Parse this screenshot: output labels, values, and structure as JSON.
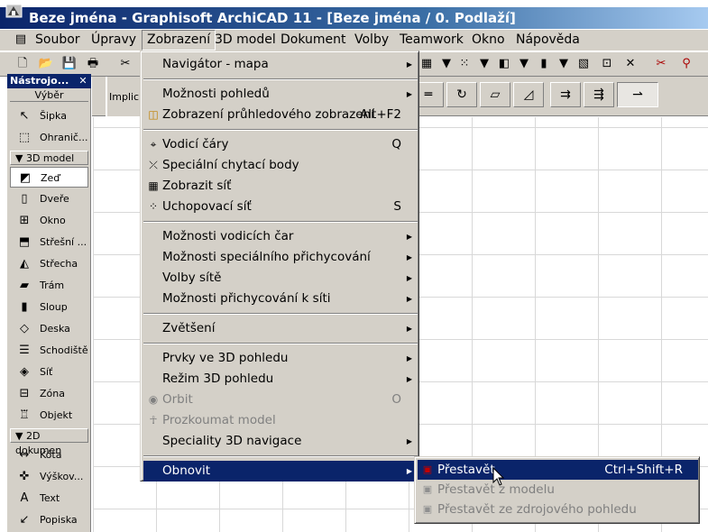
{
  "window": {
    "title": "Beze jména - Graphisoft ArchiCAD 11 - [Beze jména / 0. Podlaží]"
  },
  "menubar": [
    {
      "label": "Soubor",
      "active": false
    },
    {
      "label": "Úpravy",
      "active": false
    },
    {
      "label": "Zobrazení",
      "active": true
    },
    {
      "label": "3D model",
      "active": false
    },
    {
      "label": "Dokument",
      "active": false
    },
    {
      "label": "Volby",
      "active": false
    },
    {
      "label": "Teamwork",
      "active": false
    },
    {
      "label": "Okno",
      "active": false
    },
    {
      "label": "Nápověda",
      "active": false
    }
  ],
  "toolbox": {
    "title": "Nástrojo...",
    "select_label": "Výběr",
    "info_label": "Implicit",
    "groups": [
      {
        "header": null,
        "tools": [
          {
            "label": "Šipka",
            "icon": "arrow-icon"
          },
          {
            "label": "Ohranič...",
            "icon": "marquee-icon"
          }
        ]
      },
      {
        "header": "3D model",
        "tools": [
          {
            "label": "Zeď",
            "icon": "wall-icon",
            "selected": true
          },
          {
            "label": "Dveře",
            "icon": "door-icon"
          },
          {
            "label": "Okno",
            "icon": "window-icon"
          },
          {
            "label": "Střešní ...",
            "icon": "skylight-icon"
          },
          {
            "label": "Střecha",
            "icon": "roof-icon"
          },
          {
            "label": "Trám",
            "icon": "beam-icon"
          },
          {
            "label": "Sloup",
            "icon": "column-icon"
          },
          {
            "label": "Deska",
            "icon": "slab-icon"
          },
          {
            "label": "Schodiště",
            "icon": "stair-icon"
          },
          {
            "label": "Síť",
            "icon": "mesh-icon"
          },
          {
            "label": "Zóna",
            "icon": "zone-icon"
          },
          {
            "label": "Objekt",
            "icon": "object-icon"
          }
        ]
      },
      {
        "header": "2D dokumen",
        "tools": [
          {
            "label": "Kóta",
            "icon": "dimension-icon"
          },
          {
            "label": "Výškov...",
            "icon": "level-dimension-icon"
          },
          {
            "label": "Text",
            "icon": "text-icon"
          },
          {
            "label": "Popiska",
            "icon": "label-icon"
          }
        ]
      }
    ]
  },
  "view_menu": {
    "items": [
      {
        "label": "Navigátor - mapa",
        "submenu": true
      },
      {
        "sep": true
      },
      {
        "label": "Možnosti pohledů",
        "submenu": true
      },
      {
        "label": "Zobrazení průhledového zobrazení",
        "shortcut": "Alt+F2",
        "icon": "perspective-icon"
      },
      {
        "sep": true
      },
      {
        "label": "Vodicí čáry",
        "shortcut": "Q",
        "icon": "guide-lines-icon"
      },
      {
        "label": "Speciální chytací body",
        "icon": "snap-points-icon"
      },
      {
        "label": "Zobrazit síť",
        "icon": "grid-icon"
      },
      {
        "label": "Uchopovací síť",
        "shortcut": "S",
        "icon": "snap-grid-icon"
      },
      {
        "sep": true
      },
      {
        "label": "Možnosti vodicích čar",
        "submenu": true
      },
      {
        "label": "Možnosti speciálního přichycování",
        "submenu": true
      },
      {
        "label": "Volby sítě",
        "submenu": true
      },
      {
        "label": "Možnosti přichycování k síti",
        "submenu": true
      },
      {
        "sep": true
      },
      {
        "label": "Zvětšení",
        "submenu": true
      },
      {
        "sep": true
      },
      {
        "label": "Prvky ve 3D pohledu",
        "submenu": true
      },
      {
        "label": "Režim 3D pohledu",
        "submenu": true
      },
      {
        "label": "Orbit",
        "shortcut": "O",
        "disabled": true,
        "icon": "orbit-icon"
      },
      {
        "label": "Prozkoumat model",
        "disabled": true,
        "icon": "explore-icon"
      },
      {
        "label": "Speciality 3D navigace",
        "submenu": true
      },
      {
        "sep": true
      },
      {
        "label": "Obnovit",
        "submenu": true,
        "highlighted": true
      }
    ]
  },
  "rebuild_submenu": {
    "items": [
      {
        "label": "Přestavět",
        "shortcut": "Ctrl+Shift+R",
        "highlighted": true,
        "icon": "rebuild-icon"
      },
      {
        "label": "Přestavět z modelu",
        "disabled": true,
        "icon": "rebuild-model-icon"
      },
      {
        "label": "Přestavět ze zdrojového pohledu",
        "disabled": true,
        "icon": "rebuild-source-icon"
      }
    ]
  },
  "colors": {
    "title_bar": "#0a246a",
    "highlight": "#0a246a",
    "face": "#d4d0c8",
    "grid": "#d8d8d8"
  }
}
